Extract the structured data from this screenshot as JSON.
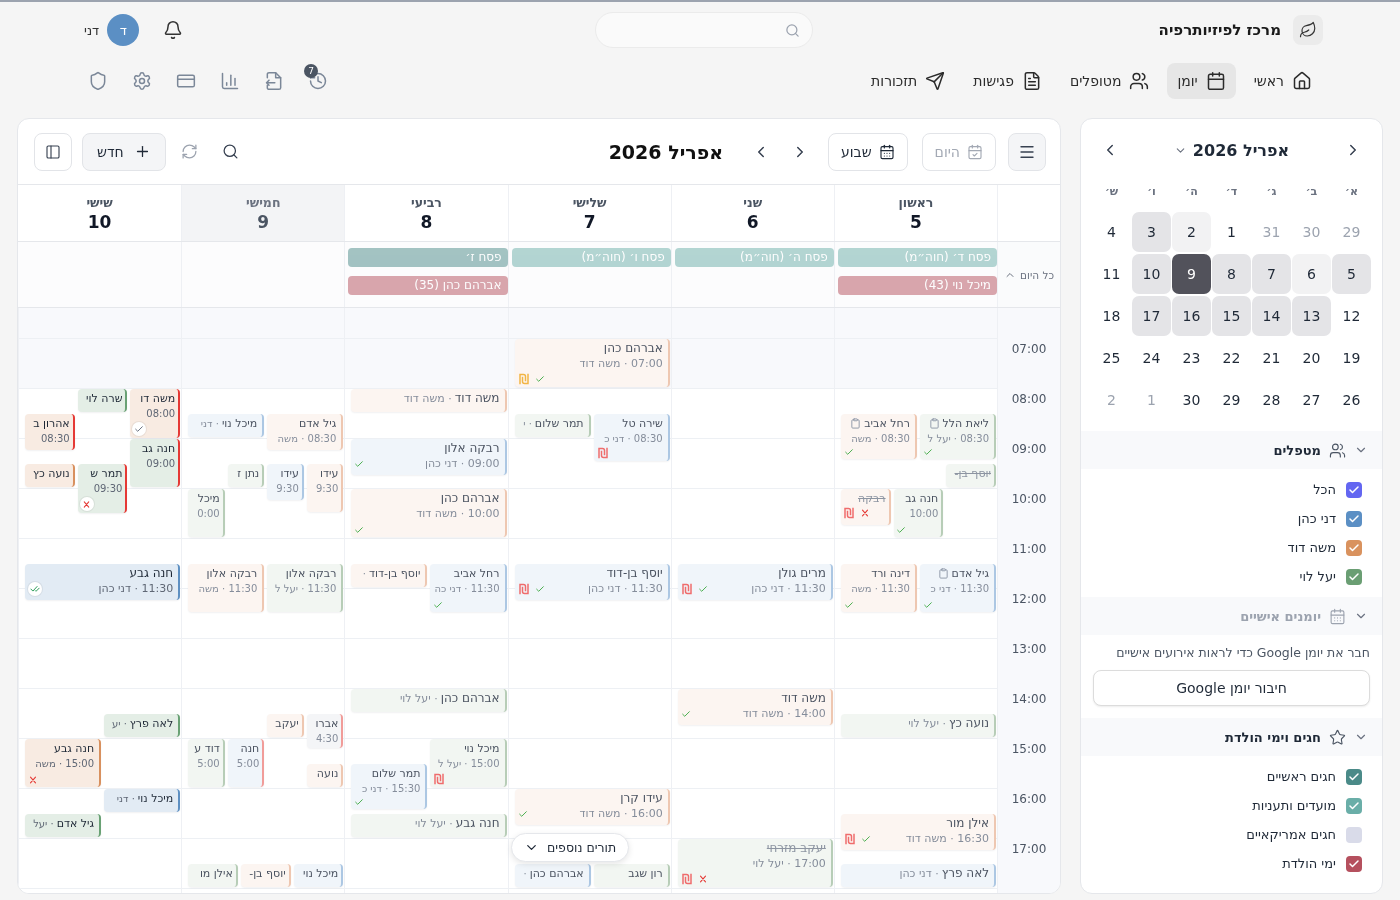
{
  "header": {
    "title": "מרכז לפיזיותרפיה",
    "user": {
      "initial": "ד",
      "name": "דני"
    }
  },
  "nav": {
    "items": [
      {
        "label": "ראשי",
        "selected": false
      },
      {
        "label": "יומן",
        "selected": true
      },
      {
        "label": "מטופלים",
        "selected": false
      },
      {
        "label": "פגישות",
        "selected": false
      },
      {
        "label": "תזכורות",
        "selected": false
      }
    ],
    "badge": "7"
  },
  "calendar": {
    "toolbar": {
      "today": {
        "label": "היום",
        "disabled": true
      },
      "view": "שבוע",
      "title": "אפריל 2026",
      "new": "חדש"
    },
    "days": [
      {
        "name": "ראשון",
        "date": "5",
        "today": false,
        "past": true,
        "all_day": [
          {
            "label": "פסח ד׳ (חוה״מ)",
            "kind": "moed"
          },
          {
            "label": "מיכל נוי (43)",
            "kind": "birthday"
          }
        ]
      },
      {
        "name": "שני",
        "date": "6",
        "today": false,
        "past": true,
        "all_day": [
          {
            "label": "פסח ה׳ (חוה״מ)",
            "kind": "moed"
          }
        ]
      },
      {
        "name": "שלישי",
        "date": "7",
        "today": false,
        "past": true,
        "all_day": [
          {
            "label": "פסח ו׳ (חוה״מ)",
            "kind": "moed"
          }
        ]
      },
      {
        "name": "רביעי",
        "date": "8",
        "today": false,
        "past": true,
        "all_day": [
          {
            "label": "פסח ז׳",
            "kind": "holiday"
          },
          {
            "label": "אברהם כהן (35)",
            "kind": "birthday"
          }
        ]
      },
      {
        "name": "חמישי",
        "date": "9",
        "today": true,
        "past": true
      },
      {
        "name": "שישי",
        "date": "10",
        "today": false,
        "past": false
      }
    ],
    "all_day": {
      "label": "כל היום",
      "expanded": true
    },
    "rows": [
      {
        "hour": "07:00",
        "cells": [
          {},
          {},
          {
            "events": [
              {
                "kind": "long",
                "half_past": false,
                "name": "אברהם כהן",
                "detail": "07:00 · משה דוד",
                "color": "#fcf5f1",
                "flagged": false,
                "cancelled": false,
                "form": false,
                "marks": [
                  {
                    "kind": "check"
                  },
                  {
                    "kind": "pending"
                  }
                ]
              }
            ]
          },
          {},
          {},
          {}
        ]
      },
      {
        "hour": "08:00",
        "cells": [
          {
            "events": [
              {
                "kind": "medium",
                "half_past": true,
                "name": "ליאת הלל",
                "detail": "08:30 · יעל ל",
                "color": "#f2f6f2",
                "flagged": false,
                "cancelled": false,
                "form": true,
                "marks": [
                  {
                    "kind": "check"
                  }
                ]
              },
              {
                "kind": "medium",
                "half_past": true,
                "name": "רחל אביב",
                "detail": "08:30 · משה",
                "color": "#fcf5f1",
                "flagged": false,
                "cancelled": false,
                "form": true,
                "marks": [
                  {
                    "kind": "check"
                  }
                ]
              }
            ]
          },
          {},
          {
            "events": [
              {
                "kind": "medium",
                "half_past": true,
                "name": "שירה טל",
                "detail": "08:30 · דני כ",
                "color": "#f0f5fa",
                "flagged": false,
                "cancelled": false,
                "form": false,
                "marks": [
                  {
                    "kind": "unpaid"
                  }
                ]
              },
              {
                "kind": "short",
                "half_past": true,
                "name": "תמר שלום",
                "detail": "· י",
                "color": "#f2f6f2",
                "flagged": false,
                "cancelled": false,
                "form": false
              }
            ]
          },
          {
            "events": [
              {
                "kind": "short",
                "half_past": false,
                "name": "משה דוד",
                "detail": "· משה דוד",
                "color": "#fcf5f1",
                "flagged": false,
                "cancelled": false,
                "form": false
              }
            ]
          },
          {
            "events": [
              {
                "kind": "medium",
                "half_past": true,
                "name": "גיל אדם",
                "detail": "08:30 · משה",
                "color": "#fcf5f1",
                "flagged": false,
                "cancelled": false,
                "form": false
              },
              {
                "kind": "short",
                "half_past": true,
                "name": "מיכל נוי",
                "detail": "· דני",
                "color": "#f0f5fa",
                "flagged": false,
                "cancelled": false,
                "form": false
              }
            ]
          },
          {
            "events": [
              {
                "kind": "medium",
                "half_past": false,
                "name": "משה דו",
                "detail": "08:00",
                "color": "#f8ebe2",
                "flagged": true,
                "cancelled": false,
                "form": false,
                "marks": [
                  {
                    "kind": "seen"
                  }
                ]
              },
              {
                "kind": "short",
                "half_past": false,
                "name": "שרה לוי",
                "color": "#e4eee6",
                "flagged": false,
                "cancelled": false,
                "form": false
              },
              {
                "kind": "medium",
                "half_past": true,
                "name": "אהרון ב",
                "detail": "08:30",
                "color": "#f8ebe2",
                "flagged": true,
                "cancelled": false,
                "form": false
              }
            ]
          }
        ]
      },
      {
        "hour": "09:00",
        "cells": [
          {
            "events": [
              {
                "kind": "short",
                "half_past": true,
                "name": "יוסף בן-",
                "color": "#f2f6f2",
                "flagged": false,
                "cancelled": true,
                "form": false
              }
            ]
          },
          {},
          {},
          {
            "events": [
              {
                "kind": "medium",
                "half_past": false,
                "name": "רבקה אלון",
                "detail": "09:00 · דני כהן",
                "color": "#f0f5fa",
                "flagged": false,
                "cancelled": false,
                "form": false,
                "marks": [
                  {
                    "kind": "check"
                  }
                ]
              }
            ]
          },
          {
            "events": [
              {
                "kind": "long",
                "half_past": true,
                "name": "עידו",
                "detail": "9:30",
                "color": "#fcf5f1",
                "flagged": false,
                "cancelled": false,
                "form": false
              },
              {
                "kind": "medium",
                "half_past": true,
                "name": "עידו",
                "detail": "9:30",
                "color": "#f0f5fa",
                "flagged": false,
                "cancelled": false,
                "form": false
              },
              {
                "kind": "short",
                "half_past": true,
                "name": "נתן ז",
                "color": "#f2f6f2",
                "flagged": false,
                "cancelled": false,
                "form": false
              }
            ]
          },
          {
            "events": [
              {
                "kind": "long",
                "half_past": false,
                "name": "חנה גב",
                "detail": "09:00",
                "color": "#e4eee6",
                "flagged": true,
                "cancelled": false,
                "form": false
              },
              {
                "kind": "long",
                "half_past": true,
                "name": "תמר ש",
                "detail": "09:30",
                "color": "#e4eee6",
                "flagged": true,
                "cancelled": false,
                "form": false,
                "marks": [
                  {
                    "kind": "no-show"
                  }
                ]
              },
              {
                "kind": "short",
                "half_past": true,
                "name": "נועה כץ",
                "color": "#f8ebe2",
                "flagged": false,
                "cancelled": false,
                "form": false
              }
            ]
          }
        ]
      },
      {
        "hour": "10:00",
        "cells": [
          {
            "events": [
              {
                "kind": "long",
                "half_past": false,
                "name": "חנה גב",
                "detail": "10:00",
                "color": "#f2f6f2",
                "flagged": false,
                "cancelled": false,
                "form": false,
                "marks": [
                  {
                    "kind": "check"
                  }
                ]
              },
              {
                "kind": "medium",
                "half_past": false,
                "name": "רבקה",
                "color": "#fcf5f1",
                "flagged": false,
                "cancelled": true,
                "form": false,
                "marks": [
                  {
                    "kind": "cross"
                  },
                  {
                    "kind": "unpaid"
                  }
                ]
              }
            ]
          },
          {},
          {},
          {
            "events": [
              {
                "kind": "long",
                "half_past": false,
                "name": "אברהם כהן",
                "detail": "10:00 · משה דוד",
                "color": "#fcf5f1",
                "flagged": false,
                "cancelled": false,
                "form": false,
                "marks": [
                  {
                    "kind": "check"
                  }
                ]
              }
            ]
          },
          {
            "events": [
              {
                "kind": "long",
                "half_past": false,
                "name": "מיכל",
                "detail": "0:00",
                "color": "#f2f6f2",
                "flagged": false,
                "cancelled": false,
                "form": false
              }
            ]
          },
          {}
        ]
      },
      {
        "hour": "11:00",
        "cells": [
          {
            "events": [
              {
                "kind": "long",
                "half_past": true,
                "name": "גיל אדם",
                "detail": "11:30 · דני כ",
                "color": "#f0f5fa",
                "flagged": false,
                "cancelled": false,
                "form": true,
                "marks": [
                  {
                    "kind": "check"
                  }
                ]
              },
              {
                "kind": "long",
                "half_past": true,
                "name": "דינה ורד",
                "detail": "11:30 · משה",
                "color": "#fcf5f1",
                "flagged": false,
                "cancelled": false,
                "form": false,
                "marks": [
                  {
                    "kind": "check"
                  }
                ]
              }
            ]
          },
          {
            "events": [
              {
                "kind": "medium",
                "half_past": true,
                "name": "מרים גולן",
                "detail": "11:30 · דני כהן",
                "color": "#f0f5fa",
                "flagged": false,
                "cancelled": false,
                "form": false,
                "marks": [
                  {
                    "kind": "check"
                  },
                  {
                    "kind": "unpaid"
                  }
                ]
              }
            ]
          },
          {
            "events": [
              {
                "kind": "medium",
                "half_past": true,
                "name": "יוסף בן-דוד",
                "detail": "11:30 · דני כהן",
                "color": "#f0f5fa",
                "flagged": false,
                "cancelled": false,
                "form": false,
                "marks": [
                  {
                    "kind": "check"
                  },
                  {
                    "kind": "unpaid"
                  }
                ]
              }
            ]
          },
          {
            "events": [
              {
                "kind": "long",
                "half_past": true,
                "name": "רחל אביב",
                "detail": "11:30 · דני כה",
                "color": "#f0f5fa",
                "flagged": false,
                "cancelled": false,
                "form": false,
                "marks": [
                  {
                    "kind": "check"
                  }
                ]
              },
              {
                "kind": "short",
                "half_past": true,
                "name": "יוסף בן-דוד",
                "detail": "·",
                "color": "#fcf5f1",
                "flagged": false,
                "cancelled": false,
                "form": false
              }
            ]
          },
          {
            "events": [
              {
                "kind": "long",
                "half_past": true,
                "name": "רבקה אלון",
                "detail": "11:30 · יעל ל",
                "color": "#f2f6f2",
                "flagged": false,
                "cancelled": false,
                "form": false
              },
              {
                "kind": "long",
                "half_past": true,
                "name": "רבקה אלון",
                "detail": "11:30 · משה",
                "color": "#fcf5f1",
                "flagged": false,
                "cancelled": false,
                "form": false
              }
            ]
          },
          {
            "events": [
              {
                "kind": "medium",
                "half_past": true,
                "name": "חנה גבע",
                "detail": "11:30 · דני כהן",
                "color": "#e2ebf4",
                "flagged": false,
                "cancelled": false,
                "form": false,
                "marks": [
                  {
                    "kind": "double-check"
                  }
                ]
              }
            ]
          }
        ]
      },
      {
        "hour": "12:00",
        "cells": [
          {},
          {},
          {},
          {},
          {},
          {}
        ]
      },
      {
        "hour": "13:00",
        "cells": [
          {},
          {},
          {},
          {},
          {},
          {}
        ]
      },
      {
        "hour": "14:00",
        "cells": [
          {
            "events": [
              {
                "kind": "short",
                "half_past": true,
                "name": "נועה כץ",
                "detail": "· יעל לוי",
                "color": "#f2f6f2",
                "flagged": false,
                "cancelled": false,
                "form": false
              }
            ]
          },
          {
            "events": [
              {
                "kind": "medium",
                "half_past": false,
                "name": "משה דוד",
                "detail": "14:00 · משה דוד",
                "color": "#fcf5f1",
                "flagged": false,
                "cancelled": false,
                "form": false,
                "marks": [
                  {
                    "kind": "check"
                  }
                ]
              }
            ]
          },
          {},
          {
            "events": [
              {
                "kind": "short",
                "half_past": false,
                "name": "אברהם כהן",
                "detail": "· יעל לוי",
                "color": "#f2f6f2",
                "flagged": false,
                "cancelled": false,
                "form": false
              }
            ]
          },
          {
            "events": [
              {
                "kind": "short",
                "half_past": true,
                "name": "אברו",
                "detail": "4:30",
                "color": "#f4f5f7",
                "flagged": true,
                "cancelled": false,
                "form": false
              },
              {
                "kind": "short",
                "half_past": true,
                "name": "יעקב",
                "color": "#fcf5f1",
                "flagged": false,
                "cancelled": false,
                "form": false
              }
            ]
          },
          {
            "events": [
              {
                "kind": "short",
                "half_past": true,
                "name": "לאה פרץ",
                "detail": "· יע",
                "color": "#e4eee6",
                "flagged": false,
                "cancelled": false,
                "form": false
              }
            ]
          }
        ]
      },
      {
        "hour": "15:00",
        "cells": [
          {},
          {},
          {},
          {
            "events": [
              {
                "kind": "long",
                "half_past": false,
                "name": "מיכל נוי",
                "detail": "15:00 · יעל ל",
                "color": "#f2f6f2",
                "flagged": false,
                "cancelled": false,
                "form": false,
                "marks": [
                  {
                    "kind": "unpaid"
                  }
                ]
              },
              {
                "kind": "medium",
                "half_past": true,
                "name": "תמר שלום",
                "detail": "15:30 · דני כ",
                "color": "#f0f5fa",
                "flagged": false,
                "cancelled": false,
                "form": false,
                "marks": [
                  {
                    "kind": "check"
                  }
                ]
              }
            ]
          },
          {
            "events": [
              {
                "kind": "long",
                "half_past": false,
                "name": "חנה",
                "detail": "5:00",
                "color": "#f0f5fa",
                "flagged": true,
                "cancelled": false,
                "form": false
              },
              {
                "kind": "long",
                "half_past": false,
                "name": "דוד ע",
                "detail": "5:00",
                "color": "#f2f6f2",
                "flagged": false,
                "cancelled": false,
                "form": false
              },
              {
                "kind": "short",
                "half_past": true,
                "name": "נועה",
                "color": "#fcf5f1",
                "flagged": false,
                "cancelled": false,
                "form": false
              }
            ]
          },
          {
            "events": [
              {
                "kind": "long",
                "half_past": false,
                "name": "חנה גבע",
                "detail": "15:00 · משה",
                "color": "#f8ebe2",
                "flagged": false,
                "cancelled": false,
                "form": false,
                "marks": [
                  {
                    "kind": "cross"
                  }
                ]
              }
            ]
          }
        ]
      },
      {
        "hour": "16:00",
        "cells": [
          {
            "events": [
              {
                "kind": "medium",
                "half_past": true,
                "name": "אילן מור",
                "detail": "16:30 · משה דוד",
                "color": "#fcf5f1",
                "flagged": false,
                "cancelled": false,
                "form": false,
                "marks": [
                  {
                    "kind": "check"
                  },
                  {
                    "kind": "unpaid"
                  }
                ]
              }
            ]
          },
          {},
          {
            "events": [
              {
                "kind": "medium",
                "half_past": false,
                "name": "עידו קרן",
                "detail": "16:00 · משה דוד",
                "color": "#fcf5f1",
                "flagged": false,
                "cancelled": false,
                "form": false,
                "marks": [
                  {
                    "kind": "check"
                  }
                ]
              }
            ]
          },
          {
            "events": [
              {
                "kind": "short",
                "half_past": true,
                "name": "חנה גבע",
                "detail": "· יעל לוי",
                "color": "#f2f6f2",
                "flagged": false,
                "cancelled": false,
                "form": false
              }
            ]
          },
          {},
          {
            "events": [
              {
                "kind": "short",
                "half_past": false,
                "name": "מיכל נוי",
                "detail": "· דני",
                "color": "#e2ebf4",
                "flagged": false,
                "cancelled": false,
                "form": false
              },
              {
                "kind": "short",
                "half_past": true,
                "name": "גיל אדם",
                "detail": "· יעל",
                "color": "#e4eee6",
                "flagged": false,
                "cancelled": false,
                "form": false
              }
            ]
          }
        ]
      },
      {
        "hour": "17:00",
        "cells": [
          {
            "events": [
              {
                "kind": "short",
                "half_past": true,
                "name": "לאה פרץ",
                "detail": "· דני כהן",
                "color": "#f0f5fa",
                "flagged": false,
                "cancelled": false,
                "form": false
              }
            ]
          },
          {
            "events": [
              {
                "kind": "long",
                "half_past": false,
                "name": "יעקב מזרחי",
                "detail": "17:00 · יעל לוי",
                "color": "#f2f6f2",
                "flagged": false,
                "cancelled": true,
                "form": false,
                "marks": [
                  {
                    "kind": "cross"
                  },
                  {
                    "kind": "unpaid"
                  }
                ]
              }
            ]
          },
          {
            "events": [
              {
                "kind": "short",
                "half_past": true,
                "name": "רון שגב",
                "color": "#f2f6f2",
                "flagged": false,
                "cancelled": false,
                "form": false
              },
              {
                "kind": "short",
                "half_past": true,
                "name": "אברהם כהן",
                "detail": "·",
                "color": "#f0f5fa",
                "flagged": false,
                "cancelled": false,
                "form": false
              }
            ]
          },
          {},
          {
            "events": [
              {
                "kind": "short",
                "half_past": true,
                "name": "מיכל נוי",
                "color": "#f0f5fa",
                "flagged": false,
                "cancelled": false,
                "form": false
              },
              {
                "kind": "short",
                "half_past": true,
                "name": "יוסף בן-",
                "color": "#fcf5f1",
                "flagged": false,
                "cancelled": false,
                "form": false
              },
              {
                "kind": "short",
                "half_past": true,
                "name": "אילן מו",
                "color": "#f2f6f2",
                "flagged": false,
                "cancelled": false,
                "form": false
              }
            ]
          },
          {}
        ]
      }
    ],
    "more": "תורים נוספים"
  },
  "sidebar": {
    "month": {
      "title": "אפריל 2026",
      "weekdays": [
        "א׳",
        "ב׳",
        "ג׳",
        "ד׳",
        "ה׳",
        "ו׳",
        "ש׳"
      ],
      "weeks": [
        [
          {
            "day": "29",
            "kind": "outside",
            "selected": false
          },
          {
            "day": "30",
            "kind": "outside",
            "selected": false
          },
          {
            "day": "31",
            "kind": "outside",
            "selected": false
          },
          {
            "day": "1",
            "kind": "plain",
            "selected": false
          },
          {
            "day": "2",
            "kind": "light",
            "selected": false
          },
          {
            "day": "3",
            "kind": "week",
            "selected": false
          },
          {
            "day": "4",
            "kind": "plain",
            "selected": false
          }
        ],
        [
          {
            "day": "5",
            "kind": "week",
            "selected": false
          },
          {
            "day": "6",
            "kind": "light",
            "selected": false
          },
          {
            "day": "7",
            "kind": "week",
            "selected": false
          },
          {
            "day": "8",
            "kind": "week",
            "selected": false
          },
          {
            "day": "9",
            "kind": "week",
            "selected": true
          },
          {
            "day": "10",
            "kind": "week",
            "selected": false
          },
          {
            "day": "11",
            "kind": "plain",
            "selected": false
          }
        ],
        [
          {
            "day": "12",
            "kind": "plain",
            "selected": false
          },
          {
            "day": "13",
            "kind": "week",
            "selected": false
          },
          {
            "day": "14",
            "kind": "week",
            "selected": false
          },
          {
            "day": "15",
            "kind": "week",
            "selected": false
          },
          {
            "day": "16",
            "kind": "week",
            "selected": false
          },
          {
            "day": "17",
            "kind": "week",
            "selected": false
          },
          {
            "day": "18",
            "kind": "plain",
            "selected": false
          }
        ],
        [
          {
            "day": "19",
            "kind": "plain",
            "selected": false
          },
          {
            "day": "20",
            "kind": "plain",
            "selected": false
          },
          {
            "day": "21",
            "kind": "plain",
            "selected": false
          },
          {
            "day": "22",
            "kind": "plain",
            "selected": false
          },
          {
            "day": "23",
            "kind": "plain",
            "selected": false
          },
          {
            "day": "24",
            "kind": "plain",
            "selected": false
          },
          {
            "day": "25",
            "kind": "plain",
            "selected": false
          }
        ],
        [
          {
            "day": "26",
            "kind": "plain",
            "selected": false
          },
          {
            "day": "27",
            "kind": "plain",
            "selected": false
          },
          {
            "day": "28",
            "kind": "plain",
            "selected": false
          },
          {
            "day": "29",
            "kind": "plain",
            "selected": false
          },
          {
            "day": "30",
            "kind": "plain",
            "selected": false
          },
          {
            "day": "1",
            "kind": "outside",
            "selected": false
          },
          {
            "day": "2",
            "kind": "outside",
            "selected": false
          }
        ]
      ]
    },
    "sections": [
      {
        "title": "מטפלים",
        "kind": "checklist",
        "muted": false,
        "items": [
          {
            "label": "הכל",
            "checked": true,
            "color": "#6366f1"
          },
          {
            "label": "דני כהן",
            "checked": true,
            "color": "#5b8fc4"
          },
          {
            "label": "משה דוד",
            "checked": true,
            "color": "#d9925e"
          },
          {
            "label": "יעל לוי",
            "checked": true,
            "color": "#6a9e73"
          }
        ]
      },
      {
        "title": "יומנים אישיים",
        "kind": "connect",
        "muted": true,
        "text": "חבר את יומן Google כדי לראות אירועים אישיים",
        "button": "חיבור יומן Google"
      },
      {
        "title": "חגים וימי הולדת",
        "kind": "checklist",
        "muted": false,
        "items": [
          {
            "label": "חגים ראשיים",
            "checked": true,
            "color": "#4a8a88"
          },
          {
            "label": "מועדים ותעניות",
            "checked": true,
            "color": "#6aaea8"
          },
          {
            "label": "חגים אמריקאיים",
            "checked": false,
            "color": "#d9dbe9"
          },
          {
            "label": "ימי הולדת",
            "checked": true,
            "color": "#b5505e"
          }
        ]
      }
    ]
  }
}
